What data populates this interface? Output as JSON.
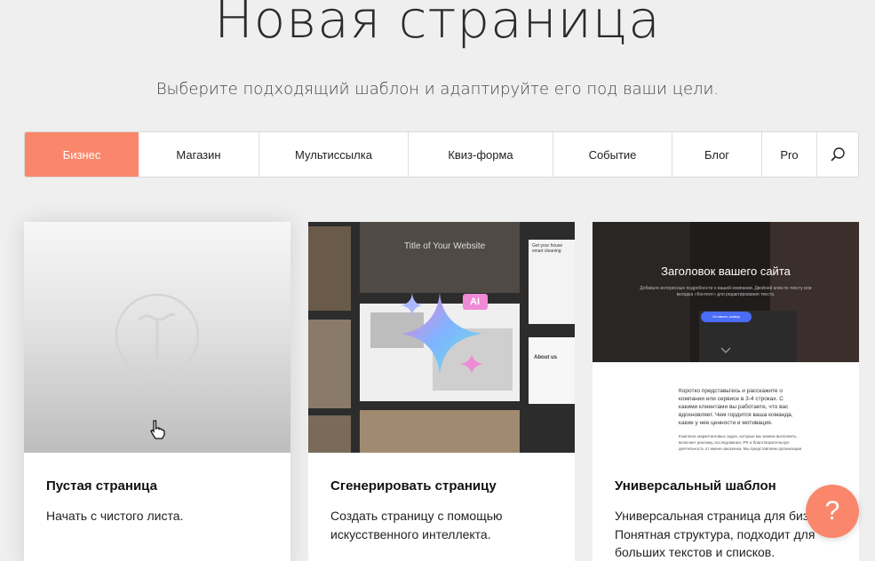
{
  "header": {
    "title": "Новая страница",
    "subtitle": "Выберите подходящий шаблон и адаптируйте его под ваши цели."
  },
  "tabs": [
    {
      "label": "Бизнес",
      "active": true
    },
    {
      "label": "Магазин"
    },
    {
      "label": "Мультиссылка"
    },
    {
      "label": "Квиз-форма"
    },
    {
      "label": "Событие"
    },
    {
      "label": "Блог"
    },
    {
      "label": "Pro"
    }
  ],
  "cards": [
    {
      "title": "Пустая страница",
      "description": "Начать с чистого листа."
    },
    {
      "title": "Сгенерировать страницу",
      "description": "Создать страницу с помощью искусственного интеллекта.",
      "thumb": {
        "site_title": "Title of Your Website",
        "badge": "AI",
        "side_heading": "Get your house smart cleaning",
        "side_about": "About us"
      }
    },
    {
      "title": "Универсальный шаблон",
      "description": "Универсальная страница для бизнеса. Понятная структура, подходит для больших текстов и списков.",
      "thumb": {
        "heading": "Заголовок вашего сайта",
        "sub": "Добавьте интересные подробности о вашей компании. Двойной клик по тексту или вкладка «Контент» для редактирования текста.",
        "button": "Оставить заявку",
        "body1": "Коротко представьтесь и расскажите о компании или сервисе в 3-4 строках. С какими клиентами вы работаете, что вас вдохновляет. Чем гордится ваша команда, какие у нее ценности и мотивация.",
        "body2": "Комплекс маркетинговых задач, которые мы можем выполнить, включает рекламу, исследования, PR и благотворительную деятельность от имени заказчика. Мы представляем организации участие компании в"
      }
    }
  ],
  "help": {
    "label": "?"
  },
  "colors": {
    "accent": "#fa876b",
    "background": "#efefef"
  }
}
